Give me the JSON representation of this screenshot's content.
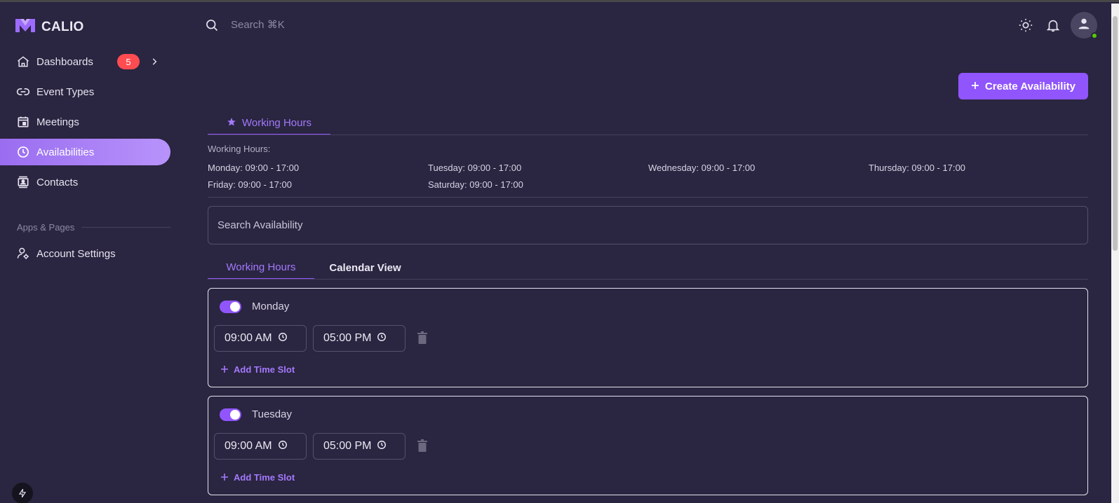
{
  "app": {
    "name": "CALIO"
  },
  "sidebar": {
    "items": [
      {
        "label": "Dashboards",
        "badge": "5",
        "icon": "home-icon"
      },
      {
        "label": "Event Types",
        "icon": "link-icon"
      },
      {
        "label": "Meetings",
        "icon": "calendar-icon"
      },
      {
        "label": "Availabilities",
        "icon": "clock-icon",
        "active": true
      },
      {
        "label": "Contacts",
        "icon": "contacts-icon"
      }
    ],
    "section_title": "Apps & Pages",
    "section_items": [
      {
        "label": "Account Settings",
        "icon": "user-cog-icon"
      }
    ]
  },
  "topbar": {
    "search_placeholder": "Search ⌘K"
  },
  "actions": {
    "create_label": "Create Availability"
  },
  "tabs": {
    "primary": "Working Hours"
  },
  "working_hours": {
    "heading": "Working Hours:",
    "entries": [
      "Monday: 09:00 - 17:00",
      "Tuesday: 09:00 - 17:00",
      "Wednesday: 09:00 - 17:00",
      "Thursday: 09:00 - 17:00",
      "Friday: 09:00 - 17:00",
      "Saturday: 09:00 - 17:00"
    ]
  },
  "search": {
    "placeholder": "Search Availability"
  },
  "subtabs": [
    "Working Hours",
    "Calendar View"
  ],
  "days": [
    {
      "name": "Monday",
      "enabled": true,
      "start": "09:00 AM",
      "end": "05:00 PM",
      "add_label": "Add Time Slot"
    },
    {
      "name": "Tuesday",
      "enabled": true,
      "start": "09:00 AM",
      "end": "05:00 PM",
      "add_label": "Add Time Slot"
    }
  ],
  "colors": {
    "accent": "#9055fd",
    "background": "#2a2540",
    "badge": "#ff4c51",
    "online": "#56ca00"
  }
}
